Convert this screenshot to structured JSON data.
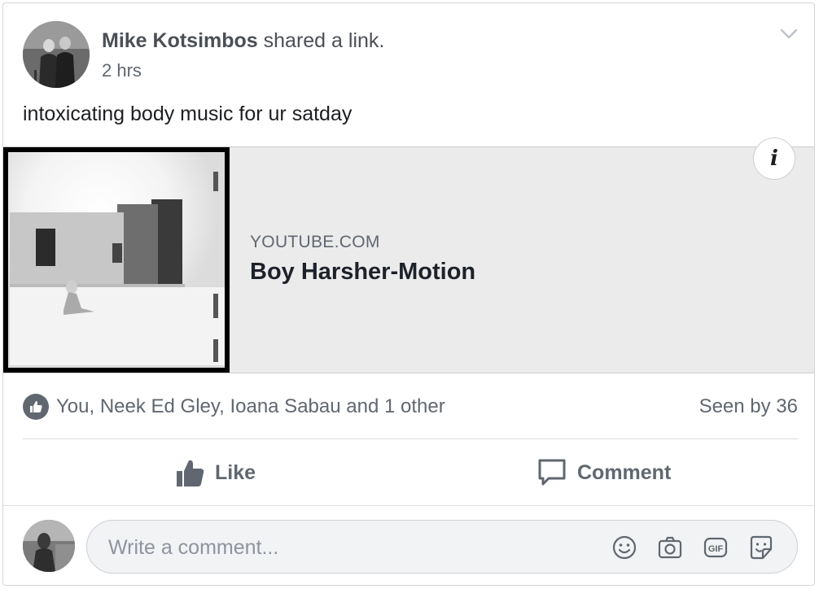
{
  "post": {
    "author_name": "Mike Kotsimbos",
    "action_text": " shared a link.",
    "timestamp": "2 hrs",
    "text": "intoxicating body music for ur satday"
  },
  "link": {
    "domain": "YOUTUBE.COM",
    "title": "Boy Harsher-Motion",
    "info_icon": "i"
  },
  "reactions": {
    "names": "You, Neek Ed Gley, Ioana Sabau and 1 other",
    "seen_by": "Seen by 36"
  },
  "actions": {
    "like_label": "Like",
    "comment_label": "Comment"
  },
  "comment": {
    "placeholder": "Write a comment..."
  },
  "icons": [
    "chevron-down-icon",
    "info-icon",
    "like-badge-icon",
    "thumbs-up-icon",
    "comment-bubble-icon",
    "emoji-icon",
    "camera-icon",
    "gif-icon",
    "sticker-icon"
  ],
  "colors": {
    "text_primary": "#1c1e21",
    "text_secondary": "#606770",
    "preview_bg": "#ebebeb"
  }
}
